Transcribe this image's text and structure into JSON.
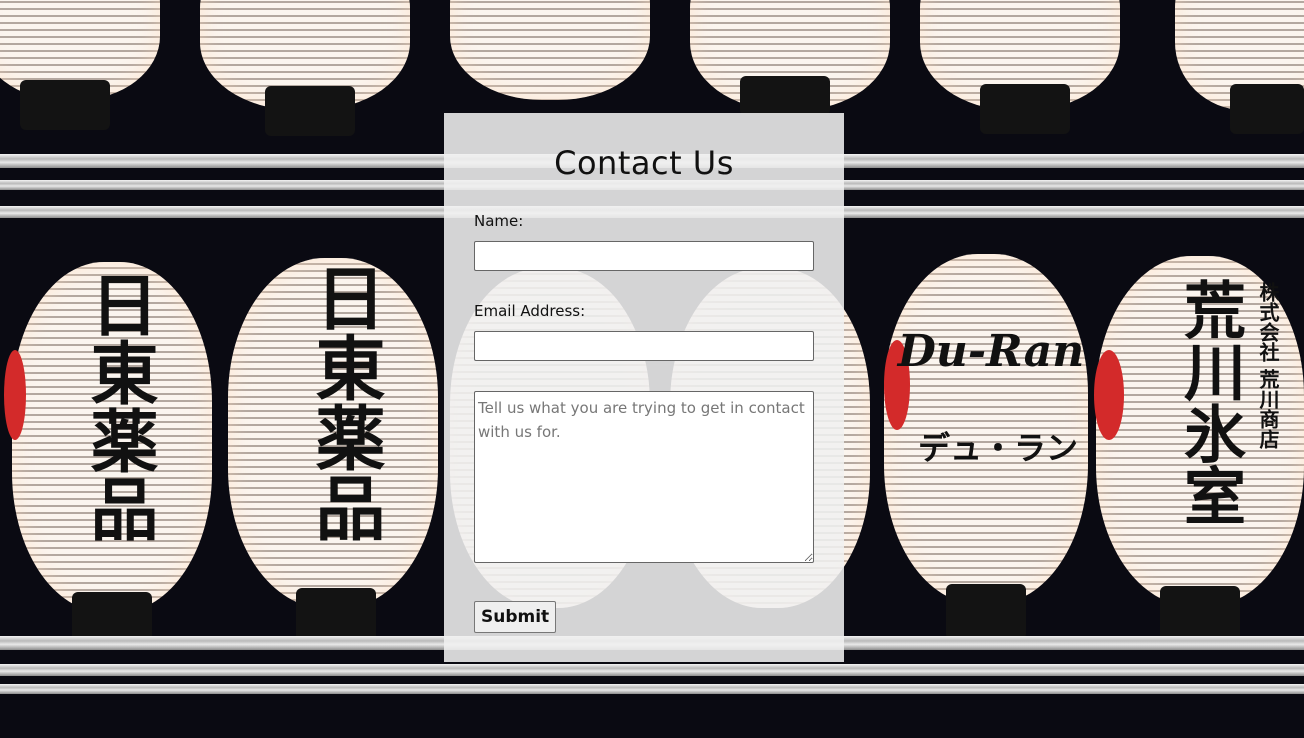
{
  "page": {
    "background_image": "night-market-paper-lanterns",
    "background_color": "#0a0a12",
    "panel_color": "#f0f0f0"
  },
  "background_text": {
    "lantern_1": "日東薬品",
    "lantern_2": "日東薬品",
    "lantern_3_top": "Du-Ran",
    "lantern_3_bottom": "デュ・ラン",
    "lantern_4": "荒川氷室",
    "lantern_4_side": "株式会社 荒川商店"
  },
  "contact_form": {
    "title": "Contact Us",
    "name_label": "Name:",
    "name_value": "",
    "email_label": "Email Address:",
    "email_value": "",
    "message_placeholder": "Tell us what you are trying to get in contact with us for.",
    "message_value": "",
    "submit_label": "Submit"
  }
}
